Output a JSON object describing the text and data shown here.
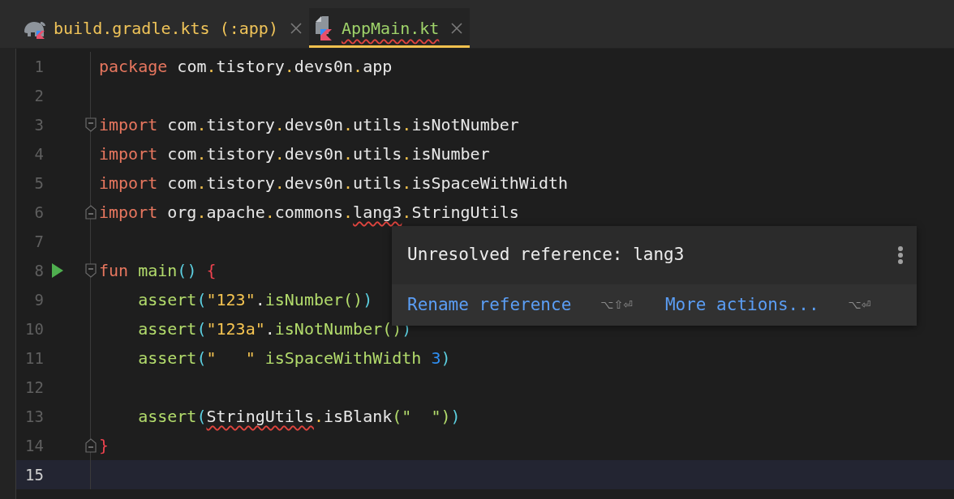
{
  "tabs": [
    {
      "label": "build.gradle.kts (:app)",
      "kind": "script",
      "selected": false,
      "color": "#f0c459",
      "error": false
    },
    {
      "label": "AppMain.kt",
      "kind": "source",
      "selected": true,
      "color": "#9fd36a",
      "error": true
    }
  ],
  "lines": [
    {
      "number": "1",
      "run": false,
      "current": false,
      "tokens": [
        {
          "t": "package",
          "kind": "keyword"
        },
        {
          "t": " com",
          "kind": "plain"
        },
        {
          "t": ".",
          "kind": "dot"
        },
        {
          "t": "tistory",
          "kind": "plain"
        },
        {
          "t": ".",
          "kind": "dot"
        },
        {
          "t": "devs0n",
          "kind": "plain"
        },
        {
          "t": ".",
          "kind": "dot"
        },
        {
          "t": "app",
          "kind": "plain"
        }
      ]
    },
    {
      "number": "2",
      "run": false,
      "current": false
    },
    {
      "number": "3",
      "run": false,
      "current": false,
      "fold": {
        "kind": "start"
      },
      "tokens": [
        {
          "t": "import",
          "kind": "keyword"
        },
        {
          "t": " com",
          "kind": "plain"
        },
        {
          "t": ".",
          "kind": "dot"
        },
        {
          "t": "tistory",
          "kind": "plain"
        },
        {
          "t": ".",
          "kind": "dot"
        },
        {
          "t": "devs0n",
          "kind": "plain"
        },
        {
          "t": ".",
          "kind": "dot"
        },
        {
          "t": "utils",
          "kind": "plain"
        },
        {
          "t": ".",
          "kind": "dot"
        },
        {
          "t": "isNotNumber",
          "kind": "plain"
        }
      ]
    },
    {
      "number": "4",
      "run": false,
      "current": false,
      "tokens": [
        {
          "t": "import",
          "kind": "keyword"
        },
        {
          "t": " com",
          "kind": "plain"
        },
        {
          "t": ".",
          "kind": "dot"
        },
        {
          "t": "tistory",
          "kind": "plain"
        },
        {
          "t": ".",
          "kind": "dot"
        },
        {
          "t": "devs0n",
          "kind": "plain"
        },
        {
          "t": ".",
          "kind": "dot"
        },
        {
          "t": "utils",
          "kind": "plain"
        },
        {
          "t": ".",
          "kind": "dot"
        },
        {
          "t": "isNumber",
          "kind": "plain"
        }
      ]
    },
    {
      "number": "5",
      "run": false,
      "current": false,
      "tokens": [
        {
          "t": "import",
          "kind": "keyword"
        },
        {
          "t": " com",
          "kind": "plain"
        },
        {
          "t": ".",
          "kind": "dot"
        },
        {
          "t": "tistory",
          "kind": "plain"
        },
        {
          "t": ".",
          "kind": "dot"
        },
        {
          "t": "devs0n",
          "kind": "plain"
        },
        {
          "t": ".",
          "kind": "dot"
        },
        {
          "t": "utils",
          "kind": "plain"
        },
        {
          "t": ".",
          "kind": "dot"
        },
        {
          "t": "isSpaceWithWidth",
          "kind": "plain"
        }
      ]
    },
    {
      "number": "6",
      "run": false,
      "current": false,
      "fold": {
        "kind": "end"
      },
      "tokens": [
        {
          "t": "import",
          "kind": "keyword"
        },
        {
          "t": " org",
          "kind": "plain"
        },
        {
          "t": ".",
          "kind": "dot"
        },
        {
          "t": "apache",
          "kind": "plain"
        },
        {
          "t": ".",
          "kind": "dot"
        },
        {
          "t": "commons",
          "kind": "plain"
        },
        {
          "t": ".",
          "kind": "dot"
        },
        {
          "t": "lang3",
          "kind": "plain",
          "error": true
        },
        {
          "t": ".",
          "kind": "dot"
        },
        {
          "t": "StringUtils",
          "kind": "plain"
        }
      ]
    },
    {
      "number": "7",
      "run": false,
      "current": false
    },
    {
      "number": "8",
      "run": true,
      "current": false,
      "fold": {
        "kind": "start"
      },
      "tokens": [
        {
          "t": "fun",
          "kind": "keyword"
        },
        {
          "t": " main",
          "kind": "func"
        },
        {
          "t": "()",
          "kind": "paren"
        },
        {
          "t": " {",
          "kind": "brace"
        }
      ]
    },
    {
      "number": "9",
      "run": false,
      "current": false,
      "tokens": [
        {
          "t": "    assert",
          "kind": "func"
        },
        {
          "t": "(",
          "kind": "paren"
        },
        {
          "t": "\"123\"",
          "kind": "string"
        },
        {
          "t": ".",
          "kind": "plain"
        },
        {
          "t": "isNumber()",
          "kind": "func"
        },
        {
          "t": ")",
          "kind": "paren"
        }
      ]
    },
    {
      "number": "10",
      "run": false,
      "current": false,
      "tokens": [
        {
          "t": "    assert",
          "kind": "func"
        },
        {
          "t": "(",
          "kind": "paren"
        },
        {
          "t": "\"123a\"",
          "kind": "string"
        },
        {
          "t": ".",
          "kind": "plain"
        },
        {
          "t": "isNotNumber()",
          "kind": "func"
        },
        {
          "t": ")",
          "kind": "paren"
        }
      ]
    },
    {
      "number": "11",
      "run": false,
      "current": false,
      "tokens": [
        {
          "t": "    assert",
          "kind": "func"
        },
        {
          "t": "(",
          "kind": "paren"
        },
        {
          "t": "\"   \"",
          "kind": "string"
        },
        {
          "t": " isSpaceWithWidth ",
          "kind": "func"
        },
        {
          "t": "3",
          "kind": "number"
        },
        {
          "t": ")",
          "kind": "paren"
        }
      ]
    },
    {
      "number": "12",
      "run": false,
      "current": false
    },
    {
      "number": "13",
      "run": false,
      "current": false,
      "tokens": [
        {
          "t": "    assert",
          "kind": "func"
        },
        {
          "t": "(",
          "kind": "paren"
        },
        {
          "t": "StringUtils",
          "kind": "plain",
          "error": true
        },
        {
          "t": ".",
          "kind": "dot"
        },
        {
          "t": "isBlank",
          "kind": "plain"
        },
        {
          "t": "(\"  \")",
          "kind": "func"
        },
        {
          "t": ")",
          "kind": "paren"
        }
      ]
    },
    {
      "number": "14",
      "run": false,
      "current": false,
      "fold": {
        "kind": "end"
      },
      "tokens": [
        {
          "t": "}",
          "kind": "brace"
        }
      ]
    },
    {
      "number": "15",
      "run": false,
      "current": true
    }
  ],
  "popup": {
    "message": "Unresolved reference: lang3",
    "actions": [
      {
        "label": "Rename reference",
        "shortcut": "⌥⇧⏎"
      },
      {
        "label": "More actions...",
        "shortcut": "⌥⏎"
      }
    ]
  }
}
